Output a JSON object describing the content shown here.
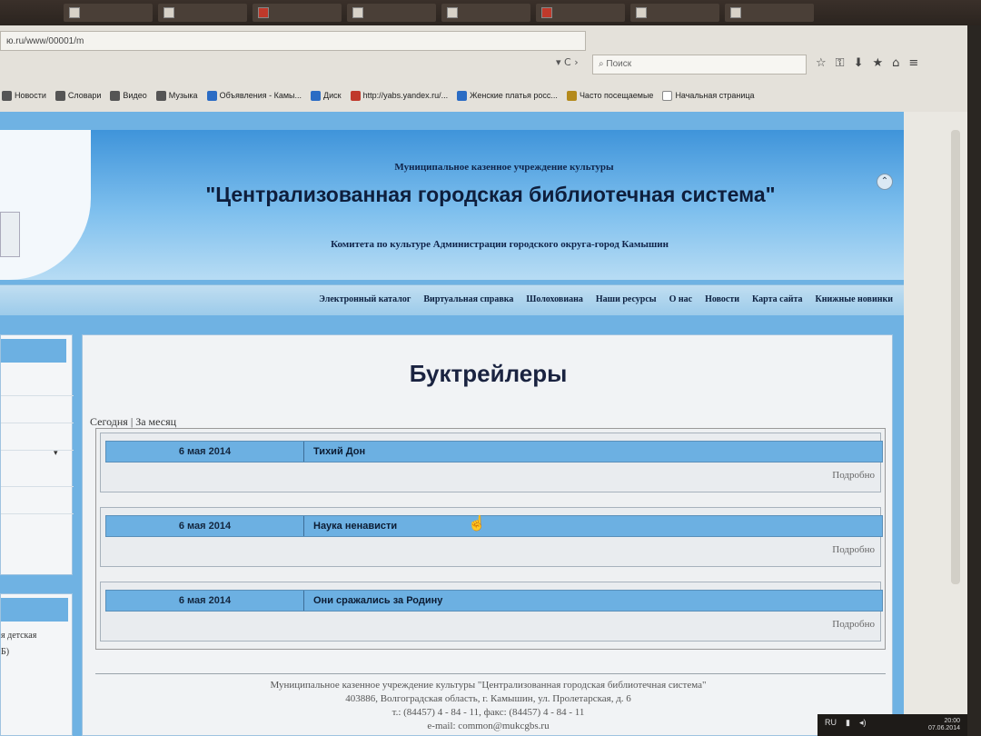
{
  "browser": {
    "url": "ю.ru/www/00001/m",
    "search_placeholder": "Поиск",
    "url_buttons": "▾ C ›",
    "toolbar_icons": [
      "star-icon",
      "lock-icon",
      "download-icon",
      "bookmark-icon",
      "home-icon",
      "menu-icon"
    ],
    "bookmarks": [
      {
        "label": "Новости",
        "icon": "news-icon"
      },
      {
        "label": "Словари",
        "icon": "dictionary-icon"
      },
      {
        "label": "Видео",
        "icon": "video-icon"
      },
      {
        "label": "Музыка",
        "icon": "music-icon"
      },
      {
        "label": "Объявления - Камы...",
        "icon": "ads-icon"
      },
      {
        "label": "Диск",
        "icon": "disk-icon"
      },
      {
        "label": "http://yabs.yandex.ru/...",
        "icon": "yandex-icon"
      },
      {
        "label": "Женские платья росс...",
        "icon": "shop-icon"
      },
      {
        "label": "Часто посещаемые",
        "icon": "frequent-icon"
      },
      {
        "label": "Начальная страница",
        "icon": "homepage-icon"
      }
    ]
  },
  "header": {
    "org_type": "Муниципальное казенное учреждение культуры",
    "title": "\"Централизованная городская библиотечная система\"",
    "subtitle": "Комитета по культуре Администрации городского округа-город Камышин"
  },
  "nav": [
    "Электронный каталог",
    "Виртуальная справка",
    "Шолоховиана",
    "Наши ресурсы",
    "О нас",
    "Новости",
    "Карта сайта",
    "Книжные новинки"
  ],
  "sidebar": {
    "text_a": "я детская",
    "text_b": "Б)"
  },
  "main": {
    "title": "Буктрейлеры",
    "filter_today": "Сегодня",
    "filter_sep": "|",
    "filter_month": "За месяц",
    "entries": [
      {
        "date": "6 мая 2014",
        "title": "Тихий Дон",
        "more": "Подробно"
      },
      {
        "date": "6 мая 2014",
        "title": "Наука ненависти",
        "more": "Подробно"
      },
      {
        "date": "6 мая 2014",
        "title": "Они сражались за Родину",
        "more": "Подробно"
      }
    ]
  },
  "footer": {
    "line1": "Муниципальное казенное учреждение культуры \"Централизованная городская библиотечная система\"",
    "line2": "403886, Волгоградская область, г. Камышин, ул. Пролетарская, д. 6",
    "line3": "т.: (84457) 4 - 84 - 11, факс: (84457) 4 - 84 - 11",
    "line4": "e-mail: common@mukcgbs.ru"
  },
  "tray": {
    "lang": "RU",
    "time": "20:00",
    "date": "07.06.2014"
  }
}
